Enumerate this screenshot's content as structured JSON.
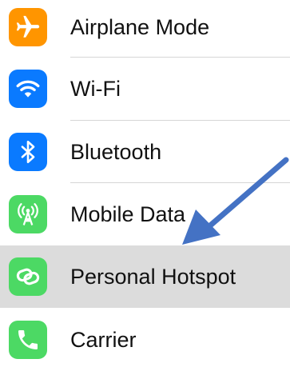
{
  "settings": {
    "rows": [
      {
        "label": "Airplane Mode",
        "icon": "airplane-icon",
        "color": "#FF9500"
      },
      {
        "label": "Wi-Fi",
        "icon": "wifi-icon",
        "color": "#0A7AFF"
      },
      {
        "label": "Bluetooth",
        "icon": "bluetooth-icon",
        "color": "#0A7AFF"
      },
      {
        "label": "Mobile Data",
        "icon": "antenna-icon",
        "color": "#4CD964"
      },
      {
        "label": "Personal Hotspot",
        "icon": "link-icon",
        "color": "#4CD964",
        "highlighted": true
      },
      {
        "label": "Carrier",
        "icon": "phone-icon",
        "color": "#4CD964"
      }
    ]
  },
  "annotation": {
    "arrow_color": "#4472C4"
  }
}
